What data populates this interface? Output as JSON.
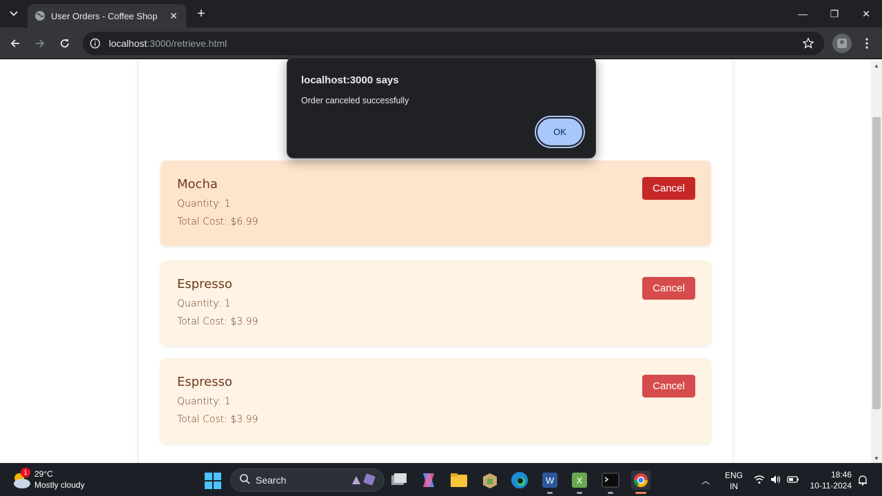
{
  "browser": {
    "tab_title": "User Orders - Coffee Shop",
    "url_host": "localhost",
    "url_path": ":3000/retrieve.html",
    "icons": [
      "tab-search-icon",
      "globe-icon",
      "close-icon",
      "plus-icon",
      "minimize-icon",
      "maximize-icon",
      "close-window-icon",
      "back-icon",
      "forward-icon",
      "reload-icon",
      "site-info-icon",
      "star-icon",
      "profile-icon",
      "kebab-menu-icon"
    ]
  },
  "dialog": {
    "title": "localhost:3000 says",
    "message": "Order canceled successfully",
    "ok_label": "OK"
  },
  "orders": [
    {
      "name": "Mocha",
      "quantity": "Quantity: 1",
      "total": "Total Cost: $6.99",
      "cancel_label": "Cancel",
      "highlighted": true
    },
    {
      "name": "Espresso",
      "quantity": "Quantity: 1",
      "total": "Total Cost: $3.99",
      "cancel_label": "Cancel",
      "highlighted": false
    },
    {
      "name": "Espresso",
      "quantity": "Quantity: 1",
      "total": "Total Cost: $3.99",
      "cancel_label": "Cancel",
      "highlighted": false
    }
  ],
  "colors": {
    "card_highlight": "#fde4cc",
    "card_normal": "#fef3e4",
    "cancel_active": "#c62828",
    "cancel_normal": "#d64c4c",
    "text_brown": "#6b3a1c"
  },
  "taskbar": {
    "weather_badge": "1",
    "weather_temp": "29°C",
    "weather_desc": "Mostly cloudy",
    "search_label": "Search",
    "lang_top": "ENG",
    "lang_bottom": "IN",
    "time": "18:46",
    "date": "10-11-2024"
  }
}
